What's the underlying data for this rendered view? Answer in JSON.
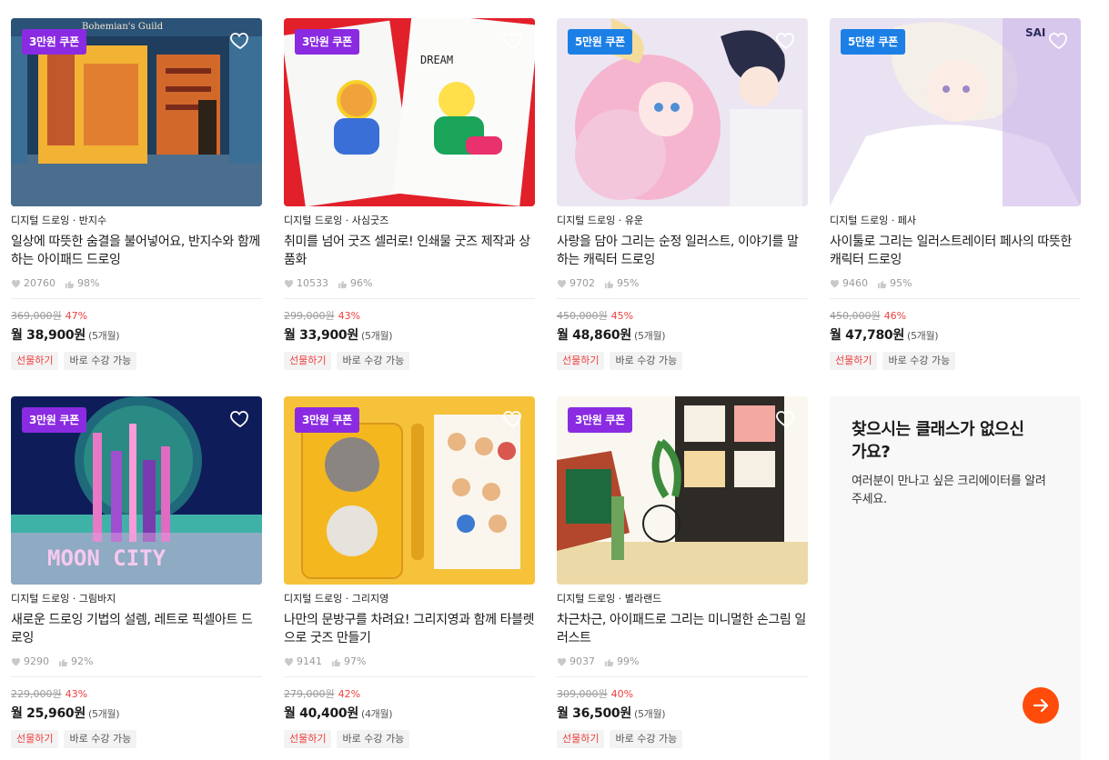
{
  "cards": [
    {
      "badge": "3만원 쿠폰",
      "badge_color": "#8a2be2",
      "category": "디지털 드로잉 · 반지수",
      "title": "일상에 따뜻한 숨결을 불어넣어요, 반지수와 함께하는 아이패드 드로잉",
      "likes": "20760",
      "rating": "98%",
      "original_price": "369,000원",
      "discount": "47%",
      "monthly": "월 38,900원",
      "months": "(5개월)",
      "gift": "선물하기",
      "instant": "바로 수강 가능",
      "image_text": "Bohemian's Guild"
    },
    {
      "badge": "3만원 쿠폰",
      "badge_color": "#8a2be2",
      "category": "디지털 드로잉 · 사심굿즈",
      "title": "취미를 넘어 굿즈 셀러로! 인쇄물 굿즈 제작과 상품화",
      "likes": "10533",
      "rating": "96%",
      "original_price": "299,000원",
      "discount": "43%",
      "monthly": "월 33,900원",
      "months": "(5개월)",
      "gift": "선물하기",
      "instant": "바로 수강 가능",
      "image_text": "DREAM"
    },
    {
      "badge": "5만원 쿠폰",
      "badge_color": "#1c7fe6",
      "category": "디지털 드로잉 · 유운",
      "title": "사랑을 담아 그리는 순정 일러스트, 이야기를 말하는 캐릭터 드로잉",
      "likes": "9702",
      "rating": "95%",
      "original_price": "450,000원",
      "discount": "45%",
      "monthly": "월 48,860원",
      "months": "(5개월)",
      "gift": "선물하기",
      "instant": "바로 수강 가능"
    },
    {
      "badge": "5만원 쿠폰",
      "badge_color": "#1c7fe6",
      "category": "디지털 드로잉 · 페사",
      "title": "사이툴로 그리는 일러스트레이터 페사의 따뜻한 캐릭터 드로잉",
      "likes": "9460",
      "rating": "95%",
      "original_price": "450,000원",
      "discount": "46%",
      "monthly": "월 47,780원",
      "months": "(5개월)",
      "gift": "선물하기",
      "instant": "바로 수강 가능",
      "image_text": "SAI"
    },
    {
      "badge": "3만원 쿠폰",
      "badge_color": "#8a2be2",
      "category": "디지털 드로잉 · 그림바지",
      "title": "새로운 드로잉 기법의 설렘, 레트로 픽셀아트 드로잉",
      "likes": "9290",
      "rating": "92%",
      "original_price": "229,000원",
      "discount": "43%",
      "monthly": "월 25,960원",
      "months": "(5개월)",
      "gift": "선물하기",
      "instant": "바로 수강 가능",
      "image_text": "MOON CITY"
    },
    {
      "badge": "3만원 쿠폰",
      "badge_color": "#8a2be2",
      "category": "디지털 드로잉 · 그리지영",
      "title": "나만의 문방구를 차려요! 그리지영과 함께 타블렛으로 굿즈 만들기",
      "likes": "9141",
      "rating": "97%",
      "original_price": "279,000원",
      "discount": "42%",
      "monthly": "월 40,400원",
      "months": "(4개월)",
      "gift": "선물하기",
      "instant": "바로 수강 가능"
    },
    {
      "badge": "3만원 쿠폰",
      "badge_color": "#8a2be2",
      "category": "디지털 드로잉 · 별라랜드",
      "title": "차근차근, 아이패드로 그리는 미니멀한 손그림 일러스트",
      "likes": "9037",
      "rating": "99%",
      "original_price": "309,000원",
      "discount": "40%",
      "monthly": "월 36,500원",
      "months": "(5개월)",
      "gift": "선물하기",
      "instant": "바로 수강 가능"
    }
  ],
  "promo": {
    "title": "찾으시는 클래스가 없으신가요?",
    "description": "여러분이 만나고 싶은 크리에이터를 알려주세요.",
    "button_icon": "arrow-right-icon",
    "button_color": "#ff4c0a"
  },
  "colors": {
    "discount": "#f03e3e",
    "purple_badge": "#8a2be2",
    "blue_badge": "#1c7fe6"
  }
}
